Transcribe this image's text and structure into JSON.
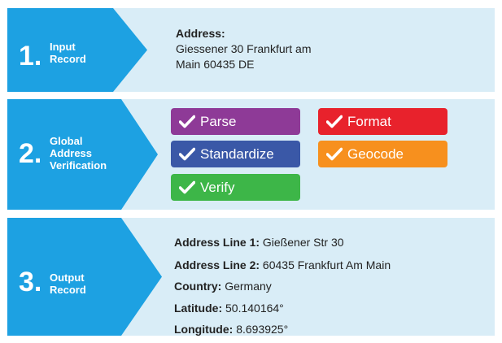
{
  "colors": {
    "row_bg": "#d9edf7",
    "arrow": "#1da1e2",
    "text": "#222222",
    "parse": "#8e3a97",
    "format": "#e8222c",
    "standardize": "#3a58a7",
    "geocode": "#f7901e",
    "verify": "#3db648"
  },
  "steps": [
    {
      "number": "1.",
      "label_lines": [
        "Input",
        "Record"
      ]
    },
    {
      "number": "2.",
      "label_lines": [
        "Global",
        "Address",
        "Verification"
      ]
    },
    {
      "number": "3.",
      "label_lines": [
        "Output",
        "Record"
      ]
    }
  ],
  "input": {
    "heading": "Address:",
    "lines": [
      "Giessener 30 Frankfurt am",
      "Main 60435 DE"
    ]
  },
  "verification": {
    "check_icon": "checkmark-icon",
    "badges": {
      "parse": "Parse",
      "format": "Format",
      "standardize": "Standardize",
      "geocode": "Geocode",
      "verify": "Verify"
    }
  },
  "output": [
    {
      "key": "Address Line 1:",
      "value": " Gießener Str 30"
    },
    {
      "key": "Address Line 2:",
      "value": " 60435 Frankfurt Am Main"
    },
    {
      "key": "Country:",
      "value": " Germany"
    },
    {
      "key": "Latitude:",
      "value": " 50.140164°"
    },
    {
      "key": "Longitude:",
      "value": " 8.693925°"
    }
  ]
}
